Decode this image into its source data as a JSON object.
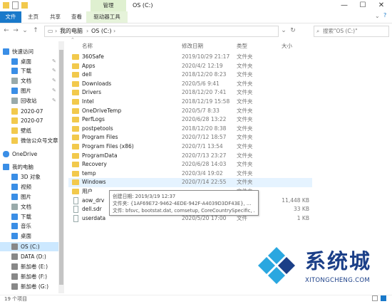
{
  "titlebar": {
    "context_tab": "管理",
    "title": "OS (C:)",
    "min": "—",
    "max": "☐",
    "close": "✕"
  },
  "tabs": {
    "file": "文件",
    "home": "主页",
    "share": "共享",
    "view": "查看",
    "drive_tools": "驱动器工具"
  },
  "address": {
    "path1": "我的电脑",
    "path2": "OS (C:)",
    "search_placeholder": "搜索\"OS (C:)\""
  },
  "columns": {
    "name": "名称",
    "date": "修改日期",
    "type": "类型",
    "size": "大小"
  },
  "sidebar": [
    {
      "label": "快速访问",
      "icon": "star-icon",
      "pin": false
    },
    {
      "label": "桌面",
      "icon": "desktop-icon",
      "pin": true
    },
    {
      "label": "下载",
      "icon": "download-icon",
      "pin": true
    },
    {
      "label": "文档",
      "icon": "document-icon",
      "pin": true
    },
    {
      "label": "图片",
      "icon": "pictures-icon",
      "pin": true
    },
    {
      "label": "回收站",
      "icon": "recycle-bin-icon",
      "pin": true
    },
    {
      "label": "2020-07",
      "icon": "folder-icon",
      "pin": false
    },
    {
      "label": "2020-07",
      "icon": "folder-icon",
      "pin": false
    },
    {
      "label": "壁纸",
      "icon": "folder-icon",
      "pin": false
    },
    {
      "label": "微信公众号文章",
      "icon": "folder-icon",
      "pin": false
    },
    {
      "label": "OneDrive",
      "icon": "cloud-icon",
      "pin": false
    },
    {
      "label": "我的电脑",
      "icon": "computer-icon",
      "pin": false
    },
    {
      "label": "3D 对象",
      "icon": "cube-icon",
      "pin": false
    },
    {
      "label": "视频",
      "icon": "video-icon",
      "pin": false
    },
    {
      "label": "图片",
      "icon": "pictures-icon",
      "pin": false
    },
    {
      "label": "文档",
      "icon": "document-icon",
      "pin": false
    },
    {
      "label": "下载",
      "icon": "download-icon",
      "pin": false
    },
    {
      "label": "音乐",
      "icon": "music-icon",
      "pin": false
    },
    {
      "label": "桌面",
      "icon": "desktop-icon",
      "pin": false
    },
    {
      "label": "OS (C:)",
      "icon": "drive-icon",
      "pin": false
    },
    {
      "label": "DATA (D:)",
      "icon": "drive-icon",
      "pin": false
    },
    {
      "label": "新加卷 (E:)",
      "icon": "drive-icon",
      "pin": false
    },
    {
      "label": "新加卷 (F:)",
      "icon": "drive-icon",
      "pin": false
    },
    {
      "label": "新加卷 (G:)",
      "icon": "drive-icon",
      "pin": false
    }
  ],
  "files": [
    {
      "name": "360Safe",
      "date": "2019/10/29 21:17",
      "type": "文件夹",
      "size": "",
      "kind": "folder"
    },
    {
      "name": "Apps",
      "date": "2020/4/2 12:19",
      "type": "文件夹",
      "size": "",
      "kind": "folder"
    },
    {
      "name": "dell",
      "date": "2018/12/20 8:23",
      "type": "文件夹",
      "size": "",
      "kind": "folder"
    },
    {
      "name": "Downloads",
      "date": "2020/5/6 9:41",
      "type": "文件夹",
      "size": "",
      "kind": "folder"
    },
    {
      "name": "Drivers",
      "date": "2018/12/20 7:41",
      "type": "文件夹",
      "size": "",
      "kind": "folder"
    },
    {
      "name": "Intel",
      "date": "2018/12/19 15:58",
      "type": "文件夹",
      "size": "",
      "kind": "folder"
    },
    {
      "name": "OneDriveTemp",
      "date": "2020/5/7 8:33",
      "type": "文件夹",
      "size": "",
      "kind": "folder"
    },
    {
      "name": "PerfLogs",
      "date": "2020/6/28 13:22",
      "type": "文件夹",
      "size": "",
      "kind": "folder"
    },
    {
      "name": "postpetools",
      "date": "2018/12/20 8:38",
      "type": "文件夹",
      "size": "",
      "kind": "folder"
    },
    {
      "name": "Program Files",
      "date": "2020/7/12 18:57",
      "type": "文件夹",
      "size": "",
      "kind": "folder"
    },
    {
      "name": "Program Files (x86)",
      "date": "2020/7/1 13:54",
      "type": "文件夹",
      "size": "",
      "kind": "folder"
    },
    {
      "name": "ProgramData",
      "date": "2020/7/13 23:27",
      "type": "文件夹",
      "size": "",
      "kind": "folder"
    },
    {
      "name": "Recovery",
      "date": "2020/6/28 14:03",
      "type": "文件夹",
      "size": "",
      "kind": "folder"
    },
    {
      "name": "temp",
      "date": "2020/3/4 19:02",
      "type": "文件夹",
      "size": "",
      "kind": "folder"
    },
    {
      "name": "Windows",
      "date": "2020/7/14 22:55",
      "type": "文件夹",
      "size": "",
      "kind": "folder"
    },
    {
      "name": "用户",
      "date": "",
      "type": "文件夹",
      "size": "",
      "kind": "folder"
    },
    {
      "name": "aow_drv",
      "date": "",
      "type": "",
      "size": "11,448 KB",
      "kind": "file"
    },
    {
      "name": "dell.sdr",
      "date": "",
      "type": "",
      "size": "33 KB",
      "kind": "file"
    },
    {
      "name": "userdata",
      "date": "2020/5/20 17:00",
      "type": "文件",
      "size": "1 KB",
      "kind": "file"
    }
  ],
  "tooltip": {
    "line1": "创建日期: 2019/3/19 12:37",
    "line2": "文件夹: {1AF69E72-9462-4EDE-942F-A4039D3DF43E}, ...",
    "line3": "文件: bfsvc, bootstat.dat, comsetup, CoreCountrySpecific, ..."
  },
  "status": {
    "count": "19 个项目"
  },
  "watermark": {
    "text": "系统城",
    "url": "XITONGCHENG.COM"
  },
  "colors": {
    "accent": "#1979ca",
    "selected": "#cce8ff",
    "hover": "#e5f3ff",
    "folder": "#f2c94c",
    "watermark": "#1b3f88"
  }
}
